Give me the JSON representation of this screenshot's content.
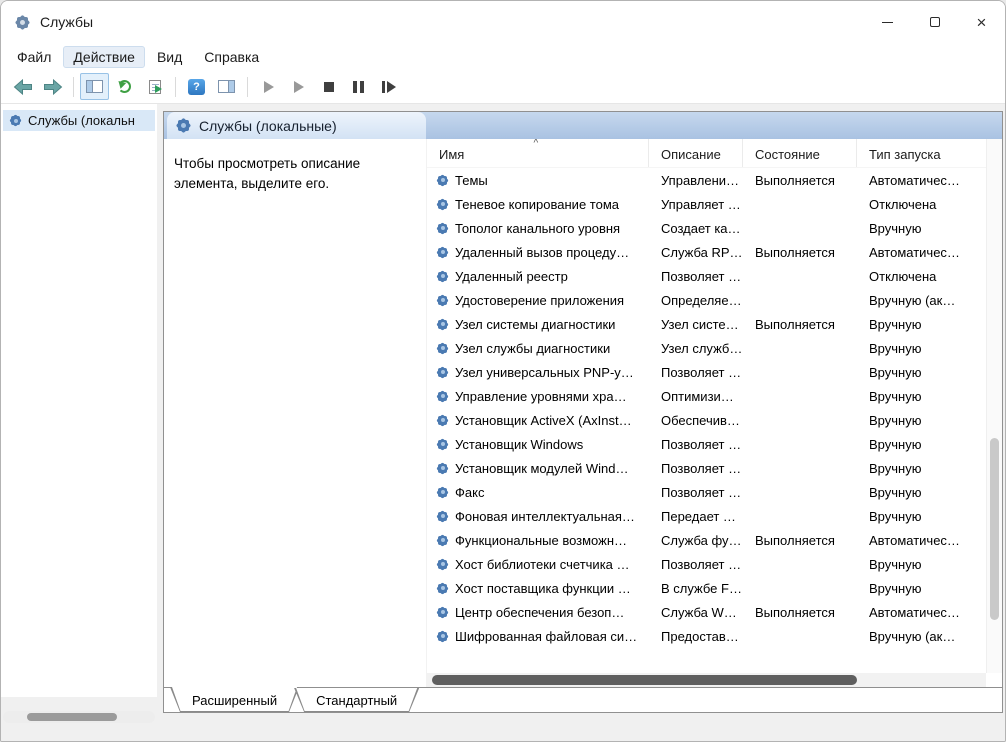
{
  "window": {
    "title": "Службы"
  },
  "icons": {
    "app_icon_name": "services-gear-icon",
    "sort_ascending": "^",
    "help": "?",
    "close": "×"
  },
  "menubar": {
    "items": [
      "Файл",
      "Действие",
      "Вид",
      "Справка"
    ],
    "highlighted_index": 1
  },
  "toolbar": {
    "buttons": [
      "back",
      "forward",
      "show-console-tree",
      "refresh",
      "export-list",
      "help",
      "show-action-pane",
      "start-service",
      "resume-service",
      "stop-service",
      "pause-service",
      "restart-service"
    ]
  },
  "tree": {
    "root_label": "Службы (локальн"
  },
  "main": {
    "header_title": "Службы (локальные)",
    "description_hint": "Чтобы просмотреть описание элемента, выделите его."
  },
  "table": {
    "columns": [
      "Имя",
      "Описание",
      "Состояние",
      "Тип запуска"
    ],
    "rows": [
      {
        "name": "Темы",
        "description": "Управлени…",
        "status": "Выполняется",
        "startup_type": "Автоматичес…"
      },
      {
        "name": "Теневое копирование тома",
        "description": "Управляет …",
        "status": "",
        "startup_type": "Отключена"
      },
      {
        "name": "Тополог канального уровня",
        "description": "Создает ка…",
        "status": "",
        "startup_type": "Вручную"
      },
      {
        "name": "Удаленный вызов процеду…",
        "description": "Служба RP…",
        "status": "Выполняется",
        "startup_type": "Автоматичес…"
      },
      {
        "name": "Удаленный реестр",
        "description": "Позволяет …",
        "status": "",
        "startup_type": "Отключена"
      },
      {
        "name": "Удостоверение приложения",
        "description": "Определяе…",
        "status": "",
        "startup_type": "Вручную (ак…"
      },
      {
        "name": "Узел системы диагностики",
        "description": "Узел систе…",
        "status": "Выполняется",
        "startup_type": "Вручную"
      },
      {
        "name": "Узел службы диагностики",
        "description": "Узел служб…",
        "status": "",
        "startup_type": "Вручную"
      },
      {
        "name": "Узел универсальных PNP-у…",
        "description": "Позволяет …",
        "status": "",
        "startup_type": "Вручную"
      },
      {
        "name": "Управление уровнями хра…",
        "description": "Оптимизи…",
        "status": "",
        "startup_type": "Вручную"
      },
      {
        "name": "Установщик ActiveX (AxInst…",
        "description": "Обеспечив…",
        "status": "",
        "startup_type": "Вручную"
      },
      {
        "name": "Установщик Windows",
        "description": "Позволяет …",
        "status": "",
        "startup_type": "Вручную"
      },
      {
        "name": "Установщик модулей Wind…",
        "description": "Позволяет …",
        "status": "",
        "startup_type": "Вручную"
      },
      {
        "name": "Факс",
        "description": "Позволяет …",
        "status": "",
        "startup_type": "Вручную"
      },
      {
        "name": "Фоновая интеллектуальная…",
        "description": "Передает …",
        "status": "",
        "startup_type": "Вручную"
      },
      {
        "name": "Функциональные возможн…",
        "description": "Служба фу…",
        "status": "Выполняется",
        "startup_type": "Автоматичес…"
      },
      {
        "name": "Хост библиотеки счетчика …",
        "description": "Позволяет …",
        "status": "",
        "startup_type": "Вручную"
      },
      {
        "name": "Хост поставщика функции …",
        "description": "В службе F…",
        "status": "",
        "startup_type": "Вручную"
      },
      {
        "name": "Центр обеспечения безоп…",
        "description": "Служба W…",
        "status": "Выполняется",
        "startup_type": "Автоматичес…"
      },
      {
        "name": "Шифрованная файловая си…",
        "description": "Предостав…",
        "status": "",
        "startup_type": "Вручную (ак…"
      }
    ]
  },
  "tabs": {
    "items": [
      "Расширенный",
      "Стандартный"
    ],
    "active_index": 0
  }
}
